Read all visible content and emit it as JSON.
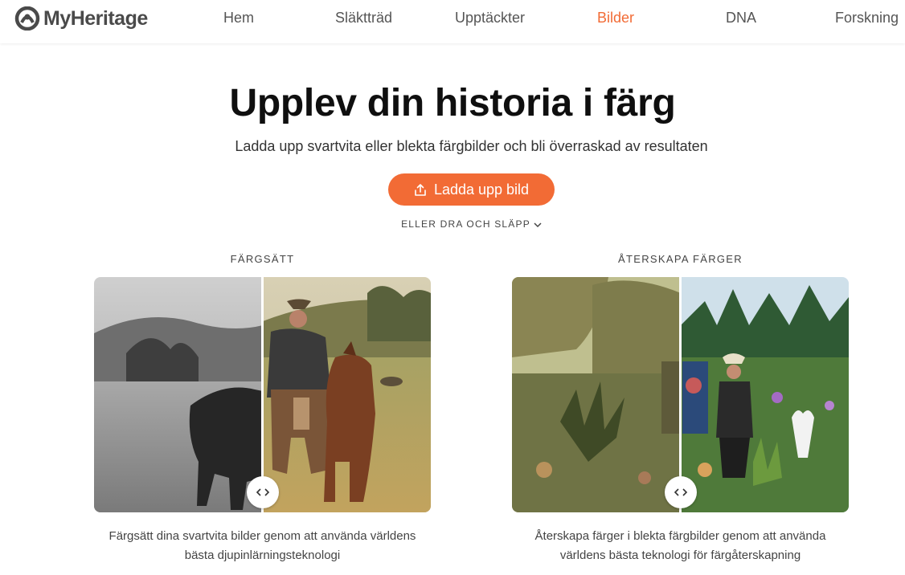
{
  "brand": {
    "name": "MyHeritage",
    "logo_icon": "myheritage-logo-icon",
    "accent": "#f26b35"
  },
  "nav": [
    {
      "label": "Hem",
      "active": false
    },
    {
      "label": "Släktträd",
      "active": false
    },
    {
      "label": "Upptäckter",
      "active": false
    },
    {
      "label": "Bilder",
      "active": true
    },
    {
      "label": "DNA",
      "active": false
    },
    {
      "label": "Forskning",
      "active": false
    }
  ],
  "hero": {
    "title": "Upplev din historia i färg",
    "subtitle": "Ladda upp svartvita eller blekta färgbilder och bli överraskad av resultaten",
    "upload_label": "Ladda upp bild",
    "upload_icon": "upload-icon",
    "drag_label": "ELLER DRA OCH SLÄPP",
    "drag_icon": "chevron-down-icon"
  },
  "features": [
    {
      "label": "FÄRGSÄTT",
      "description_line1": "Färgsätt dina svartvita bilder genom att använda världens",
      "description_line2": "bästa djupinlärningsteknologi",
      "handle_icon": "compare-arrows-icon"
    },
    {
      "label": "ÅTERSKAPA FÄRGER",
      "description_line1": "Återskapa färger i blekta färgbilder genom att använda",
      "description_line2": "världens bästa teknologi för färgåterskapning",
      "handle_icon": "compare-arrows-icon"
    }
  ]
}
